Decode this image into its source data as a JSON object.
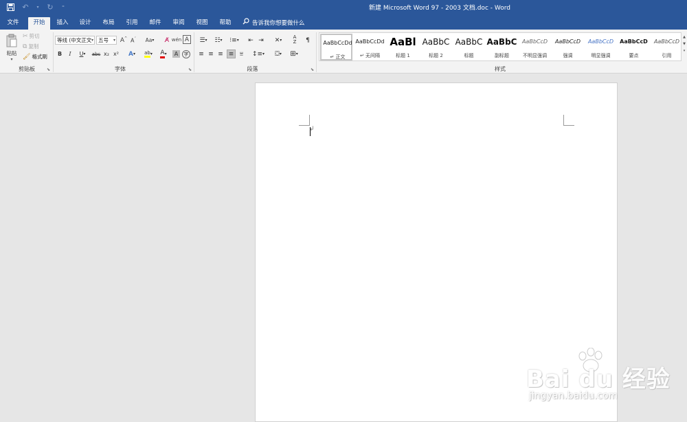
{
  "titlebar": {
    "title": "新建 Microsoft Word 97 - 2003 文档.doc  -  Word"
  },
  "tabs": [
    {
      "label": "文件"
    },
    {
      "label": "开始"
    },
    {
      "label": "插入"
    },
    {
      "label": "设计"
    },
    {
      "label": "布局"
    },
    {
      "label": "引用"
    },
    {
      "label": "邮件"
    },
    {
      "label": "审阅"
    },
    {
      "label": "视图"
    },
    {
      "label": "帮助"
    }
  ],
  "tellme": {
    "label": "告诉我你想要做什么"
  },
  "clipboard": {
    "paste": "粘贴",
    "cut": "剪切",
    "copy": "复制",
    "format_painter": "格式刷",
    "group": "剪贴板"
  },
  "font": {
    "name": "等线 (中文正文",
    "size": "五号",
    "group": "字体",
    "aa": "Aa",
    "bold": "B",
    "italic": "I",
    "underline": "U",
    "strike": "abc",
    "sub": "x₂",
    "sup": "x²"
  },
  "paragraph": {
    "group": "段落"
  },
  "styles": {
    "group": "样式",
    "items": [
      {
        "sample": "AaBbCcDd",
        "name": "↵ 正文"
      },
      {
        "sample": "AaBbCcDd",
        "name": "↵ 无间隔"
      },
      {
        "sample": "AaBl",
        "name": "标题 1"
      },
      {
        "sample": "AaBbC",
        "name": "标题 2"
      },
      {
        "sample": "AaBbC",
        "name": "标题"
      },
      {
        "sample": "AaBbC",
        "name": "副标题"
      },
      {
        "sample": "AaBbCcD",
        "name": "不明显强调"
      },
      {
        "sample": "AaBbCcD",
        "name": "强调"
      },
      {
        "sample": "AaBbCcD",
        "name": "明显强调"
      },
      {
        "sample": "AaBbCcD",
        "name": "要点"
      },
      {
        "sample": "AaBbCcD",
        "name": "引用"
      }
    ]
  },
  "document": {
    "paragraph_mark": "↲"
  },
  "watermark": {
    "main": "Bai du 经验",
    "sub": "jingyan.baidu.com"
  },
  "colors": {
    "accent": "#2b579a",
    "ribbon": "#f3f3f3",
    "canvas": "#e6e6e6"
  }
}
